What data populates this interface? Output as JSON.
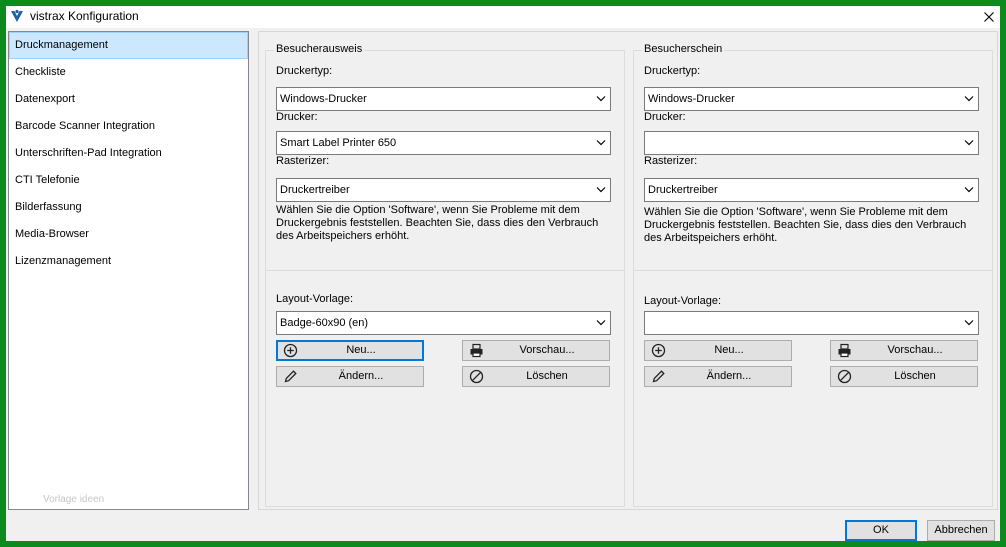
{
  "window": {
    "title": "vistrax Konfiguration"
  },
  "sidebar": {
    "items": [
      {
        "label": "Druckmanagement",
        "selected": true
      },
      {
        "label": "Checkliste"
      },
      {
        "label": "Datenexport"
      },
      {
        "label": "Barcode Scanner Integration"
      },
      {
        "label": "Unterschriften-Pad Integration"
      },
      {
        "label": "CTI Telefonie"
      },
      {
        "label": "Bilderfassung"
      },
      {
        "label": "Media-Browser"
      },
      {
        "label": "Lizenzmanagement"
      }
    ],
    "watermark": "Vorlage ideen"
  },
  "left_group": {
    "title": "Besucherausweis",
    "druckertyp_label": "Druckertyp:",
    "druckertyp_value": "Windows-Drucker",
    "drucker_label": "Drucker:",
    "drucker_value": "Smart Label Printer 650",
    "rasterizer_label": "Rasterizer:",
    "rasterizer_value": "Druckertreiber",
    "hint": "Wählen Sie die Option 'Software', wenn Sie Probleme mit dem Druckergebnis feststellen. Beachten Sie, dass dies den Verbrauch des Arbeitspeichers erhöht.",
    "layout_label": "Layout-Vorlage:",
    "layout_value": "Badge-60x90 (en)",
    "btn_new": "Neu...",
    "btn_preview": "Vorschau...",
    "btn_edit": "Ändern...",
    "btn_delete": "Löschen"
  },
  "right_group": {
    "title": "Besucherschein",
    "druckertyp_label": "Druckertyp:",
    "druckertyp_value": "Windows-Drucker",
    "drucker_label": "Drucker:",
    "drucker_value": "",
    "rasterizer_label": "Rasterizer:",
    "rasterizer_value": "Druckertreiber",
    "hint": "Wählen Sie die Option 'Software', wenn Sie Probleme mit dem Druckergebnis feststellen. Beachten Sie, dass dies den Verbrauch des Arbeitspeichers erhöht.",
    "layout_label": "Layout-Vorlage:",
    "layout_value": "",
    "btn_new": "Neu...",
    "btn_preview": "Vorschau...",
    "btn_edit": "Ändern...",
    "btn_delete": "Löschen"
  },
  "footer": {
    "ok_label": "OK",
    "cancel_label": "Abbrechen"
  },
  "icons": {
    "app": "vistrax-logo-icon",
    "close": "close-icon",
    "dropdown": "chevron-down-icon",
    "new": "plus-circle-icon",
    "preview": "printer-icon",
    "edit": "pencil-icon",
    "delete": "no-entry-icon"
  },
  "colors": {
    "frame": "#0c8a1e",
    "selection": "#cce8ff",
    "accent": "#0078d7",
    "logo": "#1f5fa8"
  }
}
